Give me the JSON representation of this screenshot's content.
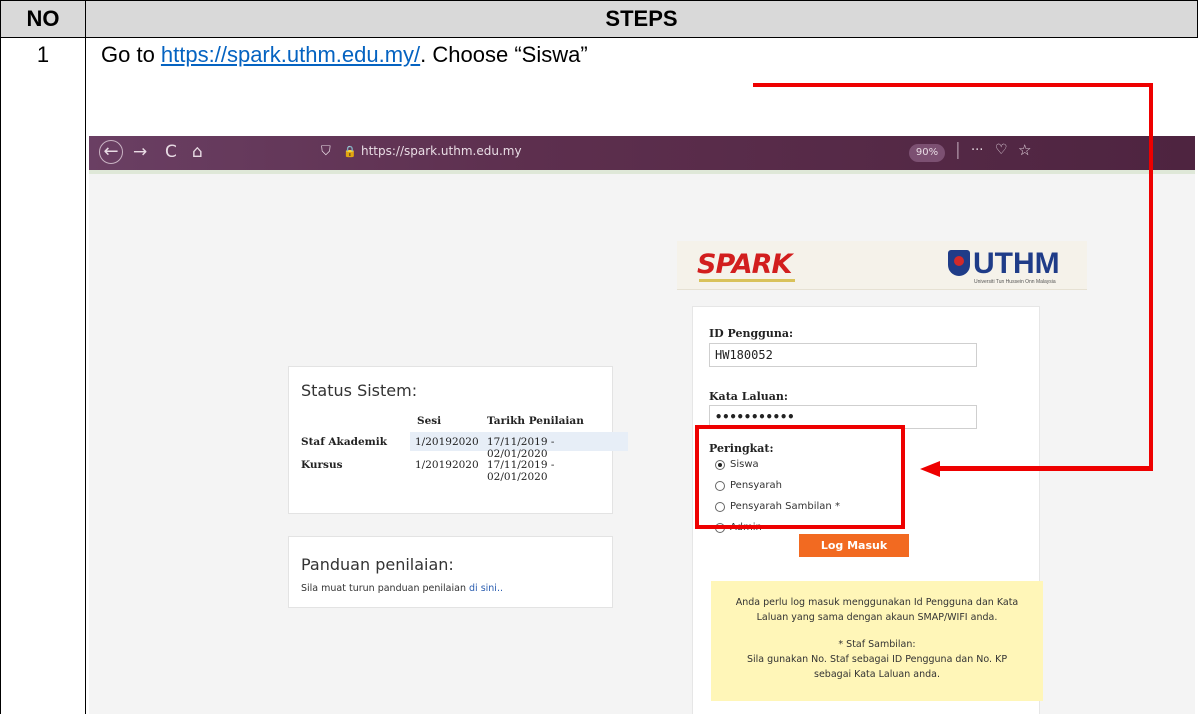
{
  "table": {
    "header_no": "NO",
    "header_steps": "STEPS",
    "row_number": "1",
    "instruction_prefix": "Go to ",
    "instruction_link": "https://spark.uthm.edu.my/",
    "instruction_suffix": ". Choose “Siswa”"
  },
  "browser": {
    "back_icon": "←",
    "forward_icon": "→",
    "reload_icon": "C",
    "home_icon": "⌂",
    "shield_icon": "⛉",
    "lock_icon": "🔒",
    "url": "https://spark.uthm.edu.my",
    "zoom": "90%",
    "menu_icon": "···",
    "pocket_icon": "♡",
    "star_icon": "☆"
  },
  "spark": {
    "logo_text": "SPARK",
    "uthm_text": "UTHM",
    "uthm_subtext": "Universiti Tun Hussein Onn Malaysia"
  },
  "login": {
    "id_label": "ID Pengguna:",
    "id_value": "HW180052",
    "password_label": "Kata Laluan:",
    "password_value": "•••••••••••",
    "level_label": "Peringkat:",
    "options": [
      "Siswa",
      "Pensyarah",
      "Pensyarah Sambilan *",
      "Admin"
    ],
    "selected_option": "Siswa",
    "login_button": "Log Masuk"
  },
  "note": {
    "line1": "Anda perlu log masuk menggunakan Id Pengguna dan Kata Laluan yang sama dengan akaun SMAP/WIFI anda.",
    "line2": "* Staf Sambilan:",
    "line3": "Sila gunakan No. Staf sebagai ID Pengguna dan No. KP sebagai Kata Laluan anda."
  },
  "status": {
    "title": "Status Sistem:",
    "col_sesi": "Sesi",
    "col_tarikh": "Tarikh Penilaian",
    "rows": [
      {
        "label": "Staf Akademik",
        "sesi": "1/20192020",
        "tarikh": "17/11/2019 - 02/01/2020"
      },
      {
        "label": "Kursus",
        "sesi": "1/20192020",
        "tarikh": "17/11/2019 - 02/01/2020"
      }
    ]
  },
  "guide": {
    "title": "Panduan penilaian:",
    "text": "Sila muat turun panduan penilaian ",
    "link": "di sini.."
  },
  "colors": {
    "annotation_red": "#ee0000",
    "login_button": "#f26a21",
    "note_bg": "#fff6b8"
  }
}
